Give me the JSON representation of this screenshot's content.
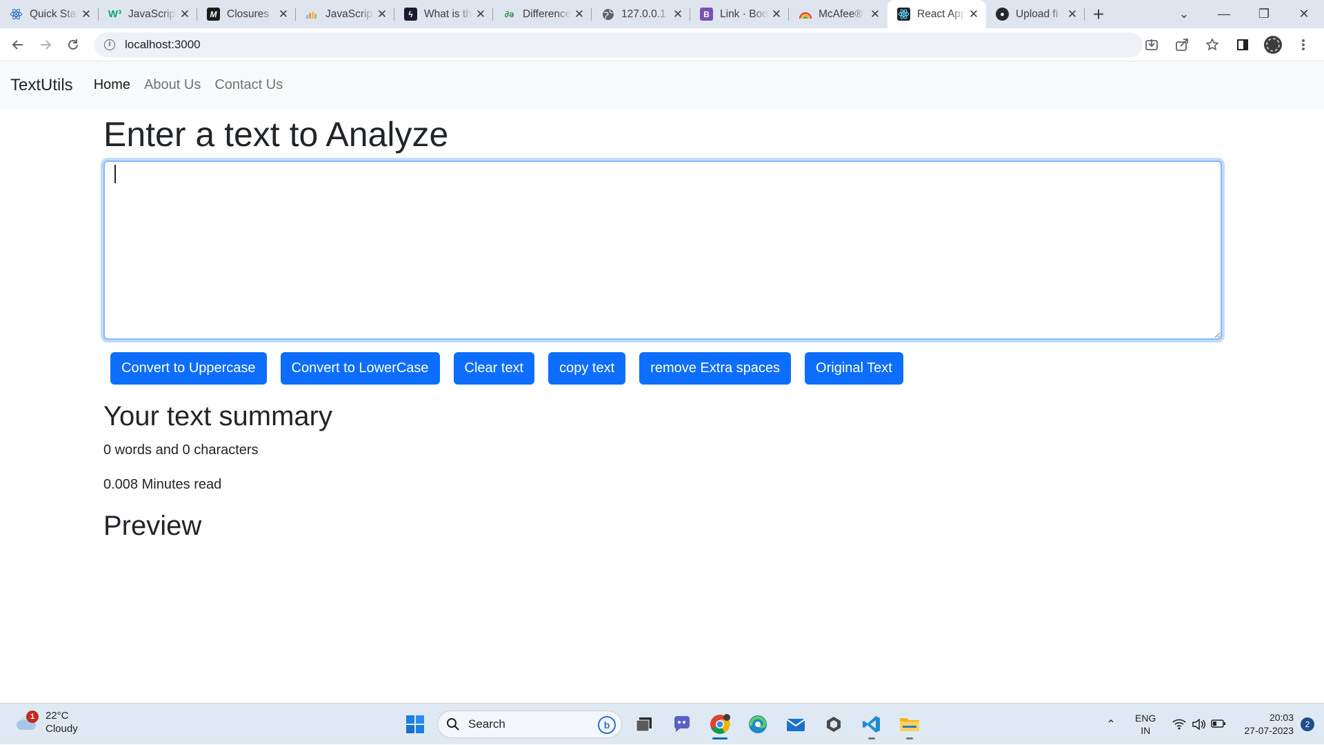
{
  "browser": {
    "tabs": [
      {
        "title": "Quick Start",
        "favicon": "react-icon",
        "active": false
      },
      {
        "title": "JavaScript",
        "favicon": "w3schools-icon",
        "active": false
      },
      {
        "title": "Closures",
        "favicon": "mdn-icon",
        "active": false
      },
      {
        "title": "JavaScript",
        "favicon": "chart-favicon-icon",
        "active": false
      },
      {
        "title": "What is the",
        "favicon": "bolt-icon",
        "active": false
      },
      {
        "title": "Difference",
        "favicon": "geeksforgeeks-icon",
        "active": false
      },
      {
        "title": "127.0.0.1",
        "favicon": "globe-icon",
        "active": false
      },
      {
        "title": "Link · Boo",
        "favicon": "bootstrap-icon",
        "active": false
      },
      {
        "title": "McAfee®",
        "favicon": "mcafee-icon",
        "active": false
      },
      {
        "title": "React App",
        "favicon": "react-icon",
        "active": true
      },
      {
        "title": "Upload fi",
        "favicon": "github-icon",
        "active": false
      }
    ],
    "new_tab": "+",
    "url": "localhost:3000"
  },
  "app": {
    "brand": "TextUtils",
    "nav": [
      {
        "label": "Home",
        "active": true
      },
      {
        "label": "About Us",
        "active": false
      },
      {
        "label": "Contact Us",
        "active": false
      }
    ],
    "heading": "Enter a text to Analyze",
    "textarea_value": "",
    "buttons": {
      "upper": "Convert to Uppercase",
      "lower": "Convert to LowerCase",
      "clear": "Clear text",
      "copy": "copy text",
      "spaces": "remove Extra spaces",
      "original": "Original Text"
    },
    "summary_heading": "Your text summary",
    "summary": "0 words and 0 characters",
    "read_time": "0.008 Minutes read",
    "preview_heading": "Preview"
  },
  "colors": {
    "primary": "#0d6efd",
    "navbar_bg": "#f8f9fa",
    "taskbar_bg": "#dfe9f3"
  },
  "taskbar": {
    "weather": {
      "temp": "22°C",
      "condition": "Cloudy",
      "badge": "1"
    },
    "search_placeholder": "Search",
    "lang": {
      "line1": "ENG",
      "line2": "IN"
    },
    "time": "20:03",
    "date": "27-07-2023",
    "notifications": "2"
  }
}
